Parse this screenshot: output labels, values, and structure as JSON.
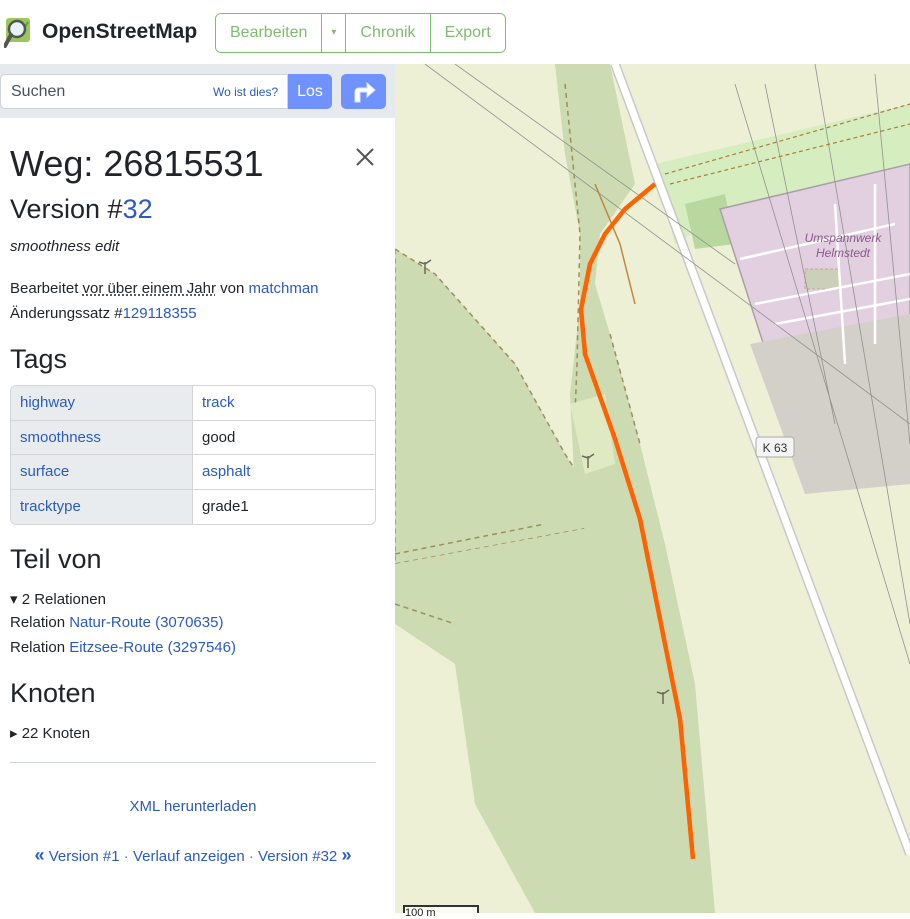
{
  "header": {
    "brand": "OpenStreetMap",
    "edit_label": "Bearbeiten",
    "history_label": "Chronik",
    "export_label": "Export",
    "accent_color": "#7ebc6f"
  },
  "search": {
    "placeholder": "Suchen",
    "where_is_this": "Wo ist dies?",
    "go_label": "Los",
    "directions_icon": "directions-icon"
  },
  "way": {
    "title": "Weg: 26815531",
    "version_prefix": "Version #",
    "version_number": "32",
    "comment": "smoothness edit",
    "edited_prefix": "Bearbeitet ",
    "edited_when": "vor über einem Jahr",
    "edited_by_prefix": " von ",
    "edited_user": "matchman",
    "changeset_prefix": "Änderungssatz #",
    "changeset_id": "129118355"
  },
  "tags_heading": "Tags",
  "tags": [
    {
      "key": "highway",
      "value": "track",
      "value_is_link": true
    },
    {
      "key": "smoothness",
      "value": "good",
      "value_is_link": false
    },
    {
      "key": "surface",
      "value": "asphalt",
      "value_is_link": true
    },
    {
      "key": "tracktype",
      "value": "grade1",
      "value_is_link": false
    }
  ],
  "part_of": {
    "heading": "Teil von",
    "count_label": "▾ 2 Relationen",
    "relations": [
      {
        "prefix": "Relation ",
        "name": "Natur-Route (3070635)"
      },
      {
        "prefix": "Relation ",
        "name": "Eitzsee-Route (3297546)"
      }
    ]
  },
  "nodes": {
    "heading": "Knoten",
    "count_label": "▸ 22 Knoten"
  },
  "footer": {
    "xml_download": "XML herunterladen",
    "first_version": "Version #1",
    "history": "Verlauf anzeigen",
    "latest_version": "Version #32"
  },
  "map": {
    "road_ref": "K 63",
    "substation_label_1": "Umspannwerk",
    "substation_label_2": "Helmstedt",
    "scale_label": "100 m",
    "highlight_color": "#ff6200"
  }
}
